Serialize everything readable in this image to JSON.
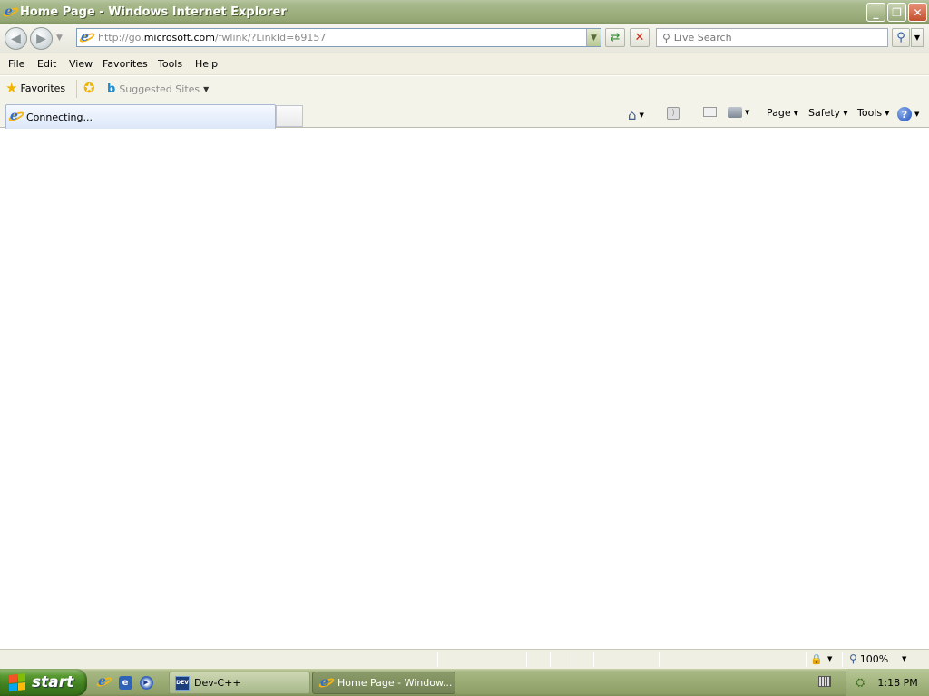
{
  "window": {
    "title": "Home Page - Windows Internet Explorer",
    "controls": {
      "minimize": "_",
      "restore": "❐",
      "close": "✕"
    }
  },
  "address": {
    "prefix": "http://go.",
    "domain": "microsoft.com",
    "suffix": "/fwlink/?LinkId=69157"
  },
  "search": {
    "placeholder": "Live Search"
  },
  "menu": [
    "File",
    "Edit",
    "View",
    "Favorites",
    "Tools",
    "Help"
  ],
  "favorites_bar": {
    "favorites_label": "Favorites",
    "suggested_sites_label": "Suggested Sites"
  },
  "tab": {
    "label": "Connecting..."
  },
  "command_bar": {
    "page": "Page",
    "safety": "Safety",
    "tools": "Tools",
    "help_glyph": "?"
  },
  "status_bar": {
    "zoom": "100%"
  },
  "taskbar": {
    "start_label": "start",
    "tasks": [
      "Dev-C++",
      "Home Page - Window..."
    ],
    "clock": "1:18 PM"
  },
  "icons": {
    "ie": "internet-explorer-icon",
    "favorites": "star-icon",
    "suggested": "bing-icon",
    "home": "home-icon",
    "feeds": "feeds-icon",
    "mail": "mail-icon",
    "print": "print-icon",
    "help": "help-icon"
  },
  "colors": {
    "titlebar": "#9eb07f",
    "start_button": "#3f7f1e",
    "ie_blue": "#2f6fcf"
  }
}
